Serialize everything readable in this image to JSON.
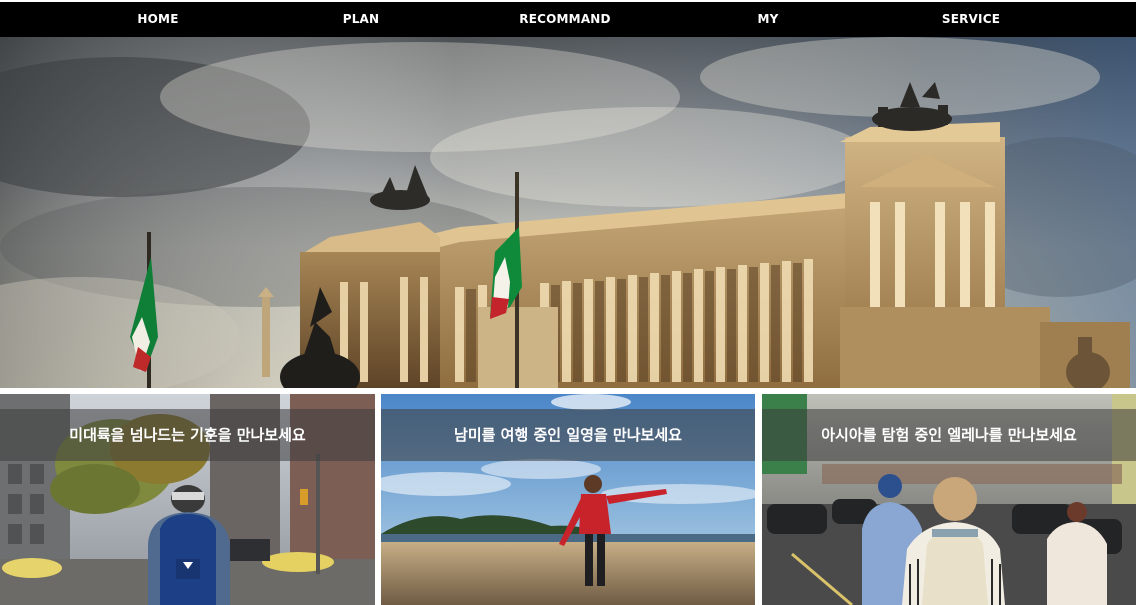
{
  "nav": {
    "items": [
      {
        "label": "HOME"
      },
      {
        "label": "PLAN"
      },
      {
        "label": "RECOMMAND"
      },
      {
        "label": "MY"
      },
      {
        "label": "SERVICE"
      }
    ]
  },
  "cards": [
    {
      "caption": "미대륙을 넘나드는 기훈을 만나보세요"
    },
    {
      "caption": "남미를 여행 중인 일영을 만나보세요"
    },
    {
      "caption": "아시아를 탐험 중인 엘레나를 만나보세요"
    }
  ],
  "colors": {
    "nav_bg": "#000000",
    "nav_text": "#ffffff",
    "caption_overlay": "rgba(60,60,60,0.55)"
  }
}
